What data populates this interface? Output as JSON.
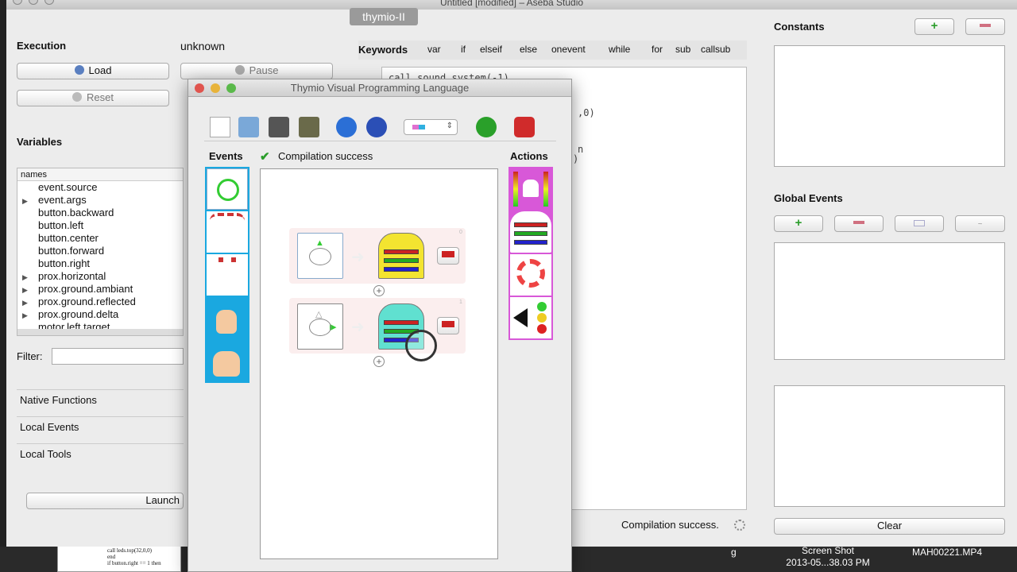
{
  "window": {
    "title": "Untitled [modified] – Aseba Studio",
    "robot_tab": "thymio-II"
  },
  "execution": {
    "title": "Execution",
    "status": "unknown",
    "load_label": "Load",
    "pause_label": "Pause",
    "reset_label": "Reset"
  },
  "variables": {
    "title": "Variables",
    "header": "names",
    "items": [
      {
        "name": "event.source",
        "expandable": false
      },
      {
        "name": "event.args",
        "expandable": true
      },
      {
        "name": "button.backward",
        "expandable": false
      },
      {
        "name": "button.left",
        "expandable": false
      },
      {
        "name": "button.center",
        "expandable": false
      },
      {
        "name": "button.forward",
        "expandable": false
      },
      {
        "name": "button.right",
        "expandable": false
      },
      {
        "name": "prox.horizontal",
        "expandable": true
      },
      {
        "name": "prox.ground.ambiant",
        "expandable": true
      },
      {
        "name": "prox.ground.reflected",
        "expandable": true
      },
      {
        "name": "prox.ground.delta",
        "expandable": true
      },
      {
        "name": "motor.left.target",
        "expandable": false
      }
    ],
    "filter_label": "Filter:",
    "filter_value": ""
  },
  "sections": {
    "native_functions": "Native Functions",
    "local_events": "Local Events",
    "local_tools": "Local Tools",
    "launch_label": "Launch"
  },
  "keywords": {
    "title": "Keywords",
    "items": [
      "var",
      "if",
      "elseif",
      "else",
      "onevent",
      "while",
      "for",
      "sub",
      "callsub"
    ]
  },
  "editor": {
    "lines": [
      "call sound.system(-1)",
      ",0)",
      "n",
      ")"
    ],
    "status": "Compilation success."
  },
  "constants": {
    "title": "Constants"
  },
  "global_events": {
    "title": "Global Events",
    "clear_label": "Clear"
  },
  "vpl": {
    "title": "Thymio Visual Programming Language",
    "events_label": "Events",
    "actions_label": "Actions",
    "compilation_status": "Compilation success",
    "pair_numbers": [
      "0",
      "1"
    ]
  },
  "desktop": {
    "screenshot_label": "Screen Shot",
    "screenshot_date": "2013-05...38.03 PM",
    "video_label": "MAH00221.MP4",
    "edge_label": "g",
    "thumb_lines": [
      "call leds.top(32,0,0)",
      "end",
      "if button.right == 1 then"
    ]
  },
  "colors": {
    "events_bg": "#1aa8e0",
    "actions_bg": "#d858d8",
    "success_check": "#2a9d2a",
    "run_button": "#2b6fd6",
    "stop_button": "#d02b2b"
  }
}
